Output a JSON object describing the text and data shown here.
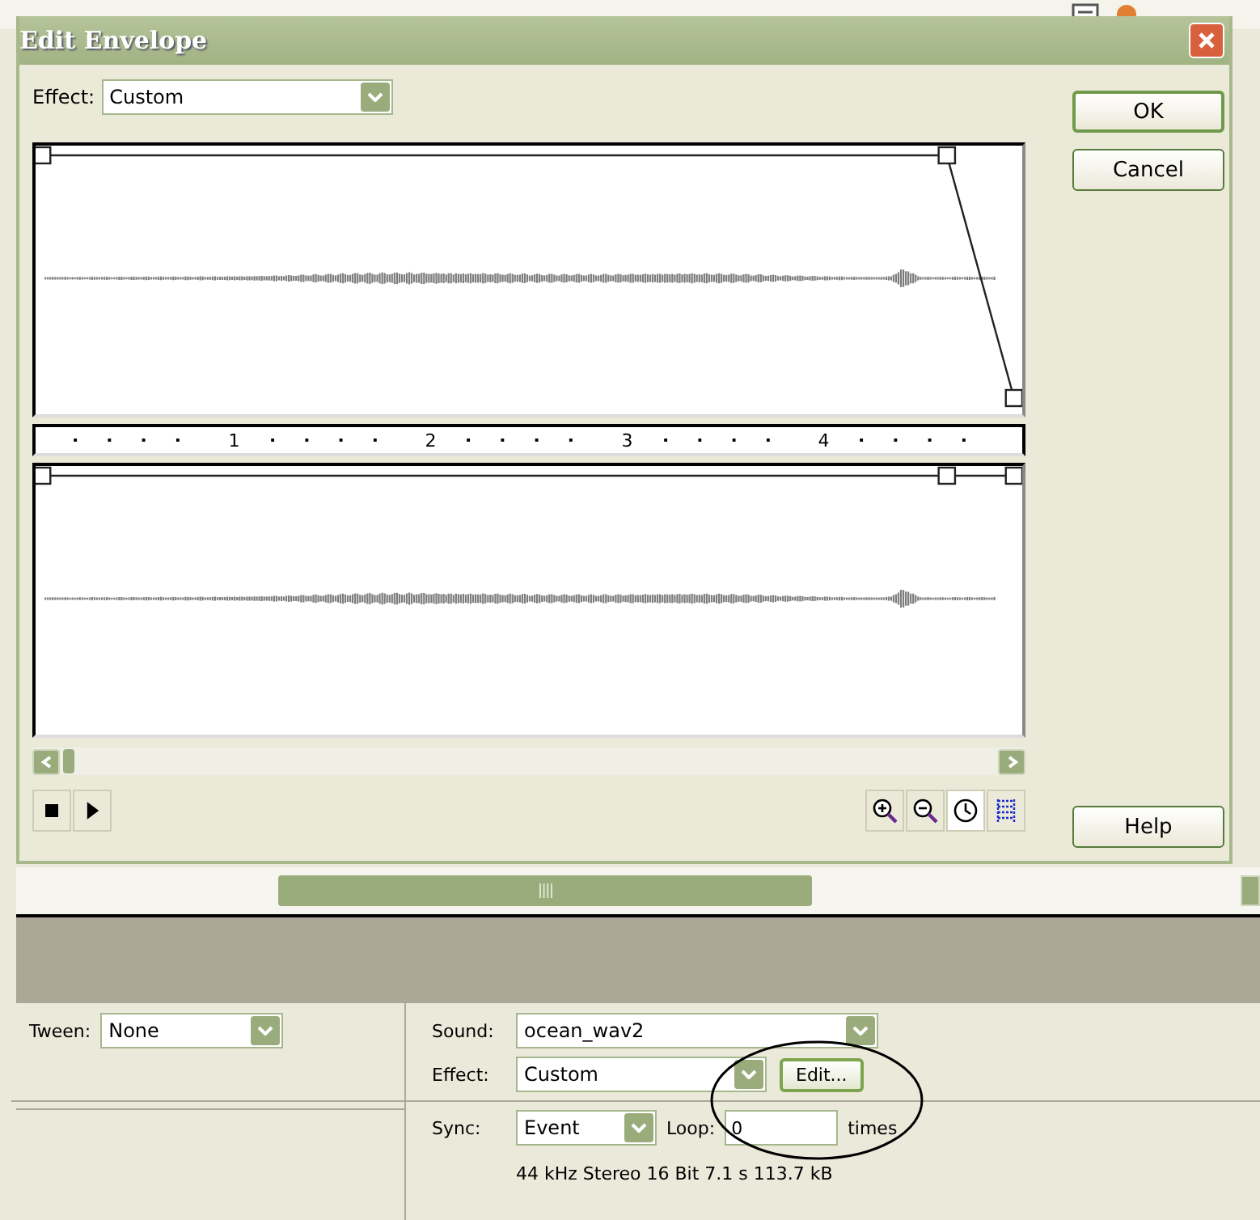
{
  "dialog": {
    "title": "Edit Envelope",
    "effect": {
      "label": "Effect:",
      "value": "Custom"
    },
    "ruler": [
      "1",
      "2",
      "3",
      "4"
    ],
    "channels": [
      {
        "kind": "fade-out"
      },
      {
        "kind": "flat"
      }
    ],
    "zoom_tools": [
      {
        "kind": "zoom-in",
        "selected": false
      },
      {
        "kind": "zoom-out",
        "selected": false
      },
      {
        "kind": "seconds",
        "selected": true
      },
      {
        "kind": "frames",
        "selected": false
      }
    ],
    "buttons": {
      "ok": "OK",
      "cancel": "Cancel",
      "help": "Help"
    }
  },
  "properties": {
    "tween": {
      "label": "Tween:",
      "value": "None"
    },
    "sound": {
      "label": "Sound:",
      "value": "ocean_wav2"
    },
    "effect": {
      "label": "Effect:",
      "value": "Custom",
      "edit_button": "Edit..."
    },
    "sync": {
      "label": "Sync:",
      "value": "Event",
      "loop_label": "Loop:",
      "loop_value": "0",
      "times": "times"
    },
    "info": "44 kHz Stereo 16 Bit 7.1 s 113.7 kB"
  }
}
